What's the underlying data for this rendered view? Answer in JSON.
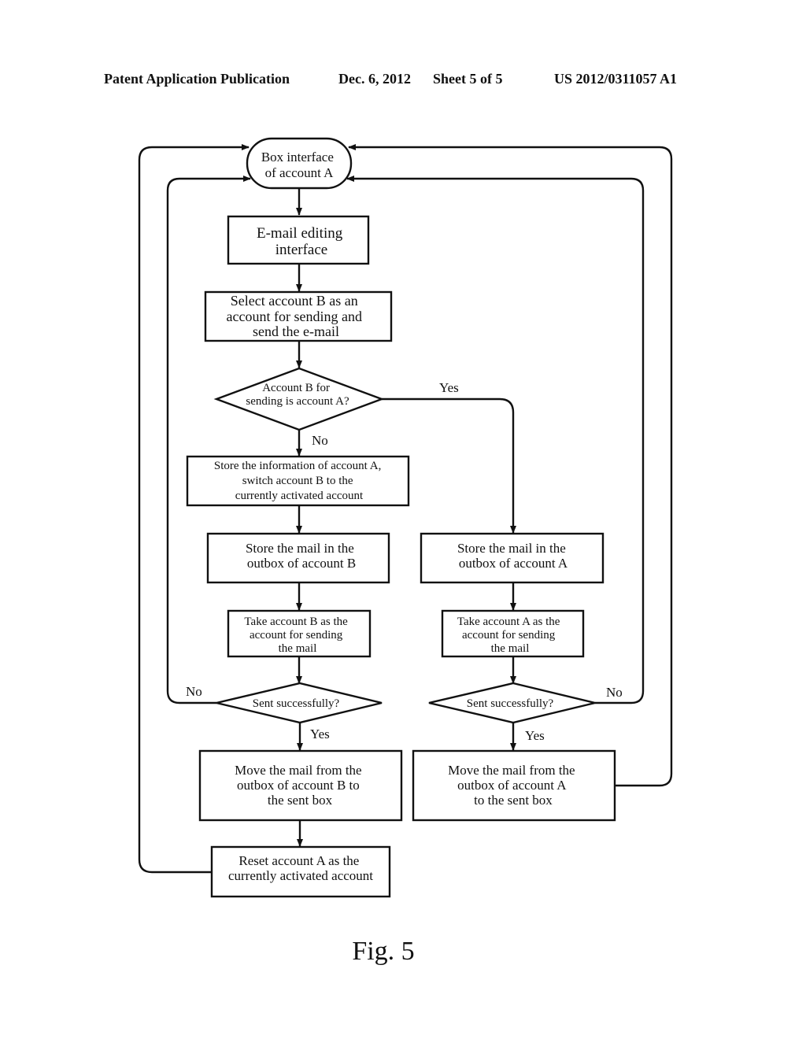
{
  "header": {
    "publication": "Patent Application Publication",
    "date": "Dec. 6, 2012",
    "sheet": "Sheet 5 of 5",
    "number": "US 2012/0311057 A1"
  },
  "diagram": {
    "nodes": {
      "box_interface": {
        "type": "terminal",
        "lines": [
          "Box interface",
          "of account A"
        ]
      },
      "email_editing": {
        "type": "process",
        "lines": [
          "E-mail editing",
          "interface"
        ]
      },
      "select_account": {
        "type": "process",
        "lines": [
          "Select account B as an",
          "account for sending and",
          "send the e-mail"
        ]
      },
      "decision_is_a": {
        "type": "decision",
        "lines": [
          "Account B for",
          "sending is account A?"
        ]
      },
      "store_info": {
        "type": "process",
        "lines": [
          "Store the information of account A,",
          "switch account B to the",
          "currently activated account"
        ]
      },
      "store_outbox_b": {
        "type": "process",
        "lines": [
          "Store the mail in the",
          "outbox of account B"
        ]
      },
      "store_outbox_a": {
        "type": "process",
        "lines": [
          "Store the mail in the",
          "outbox of account A"
        ]
      },
      "take_b": {
        "type": "process",
        "lines": [
          "Take account B as the",
          "account for sending",
          "the mail"
        ]
      },
      "take_a": {
        "type": "process",
        "lines": [
          "Take account A as the",
          "account for sending",
          "the mail"
        ]
      },
      "sent_ok_b": {
        "type": "decision",
        "lines": [
          "Sent successfully?"
        ]
      },
      "sent_ok_a": {
        "type": "decision",
        "lines": [
          "Sent successfully?"
        ]
      },
      "move_b": {
        "type": "process",
        "lines": [
          "Move the mail from the",
          "outbox of account B to",
          "the sent box"
        ]
      },
      "move_a": {
        "type": "process",
        "lines": [
          "Move the mail from the",
          "outbox of account A",
          "to the sent box"
        ]
      },
      "reset_a": {
        "type": "process",
        "lines": [
          "Reset account A as the",
          "currently activated account"
        ]
      }
    },
    "edge_labels": {
      "yes_is_a": "Yes",
      "no_is_a": "No",
      "no_sent_b": "No",
      "yes_sent_b": "Yes",
      "no_sent_a": "No",
      "yes_sent_a": "Yes"
    }
  },
  "caption": "Fig. 5"
}
